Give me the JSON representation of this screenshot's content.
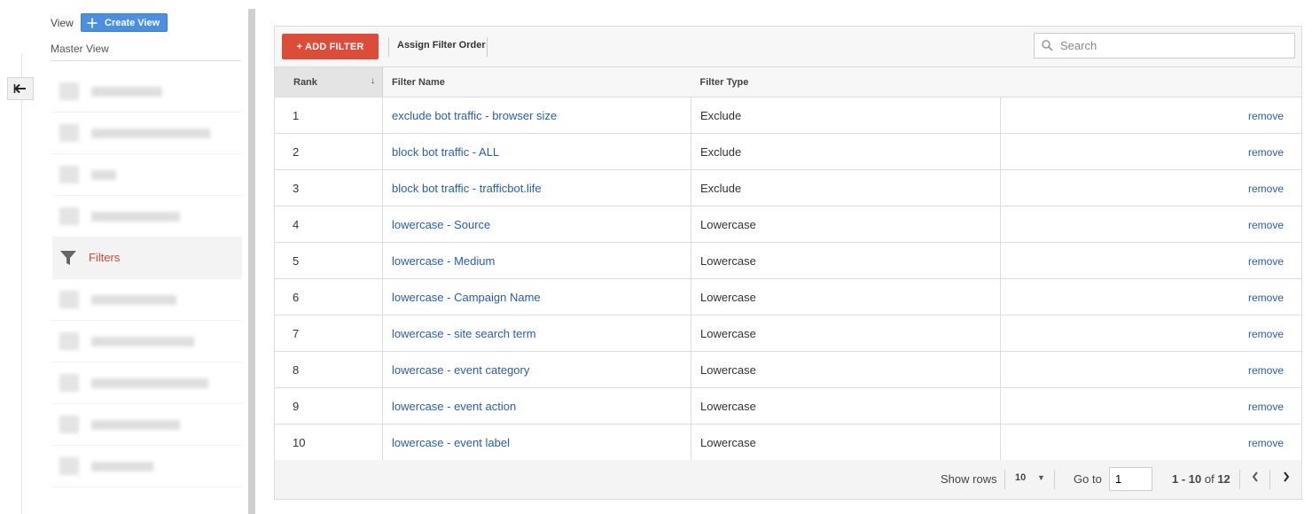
{
  "sidebar": {
    "view_label": "View",
    "create_view_label": "Create View",
    "master_view": "Master View",
    "active_item_label": "Filters"
  },
  "toolbar": {
    "add_filter_label": "+ ADD FILTER",
    "assign_order_label": "Assign Filter Order",
    "search_placeholder": "Search"
  },
  "table": {
    "headers": {
      "rank": "Rank",
      "name": "Filter Name",
      "type": "Filter Type"
    },
    "rows": [
      {
        "rank": "1",
        "name": "exclude bot traffic - browser size",
        "type": "Exclude",
        "action": "remove"
      },
      {
        "rank": "2",
        "name": "block bot traffic - ALL",
        "type": "Exclude",
        "action": "remove"
      },
      {
        "rank": "3",
        "name": "block bot traffic - trafficbot.life",
        "type": "Exclude",
        "action": "remove"
      },
      {
        "rank": "4",
        "name": "lowercase - Source",
        "type": "Lowercase",
        "action": "remove"
      },
      {
        "rank": "5",
        "name": "lowercase - Medium",
        "type": "Lowercase",
        "action": "remove"
      },
      {
        "rank": "6",
        "name": "lowercase - Campaign Name",
        "type": "Lowercase",
        "action": "remove"
      },
      {
        "rank": "7",
        "name": "lowercase - site search term",
        "type": "Lowercase",
        "action": "remove"
      },
      {
        "rank": "8",
        "name": "lowercase - event category",
        "type": "Lowercase",
        "action": "remove"
      },
      {
        "rank": "9",
        "name": "lowercase - event action",
        "type": "Lowercase",
        "action": "remove"
      },
      {
        "rank": "10",
        "name": "lowercase - event label",
        "type": "Lowercase",
        "action": "remove"
      }
    ]
  },
  "pager": {
    "show_rows_label": "Show rows",
    "rows_per_page": "10",
    "goto_label": "Go to",
    "goto_value": "1",
    "range_bold": "1 - 10",
    "range_of": " of ",
    "total": "12"
  },
  "colors": {
    "add_filter": "#dd4b39",
    "create_view": "#4a90e2",
    "link": "#2a5db0",
    "active_nav": "#d2463a"
  }
}
